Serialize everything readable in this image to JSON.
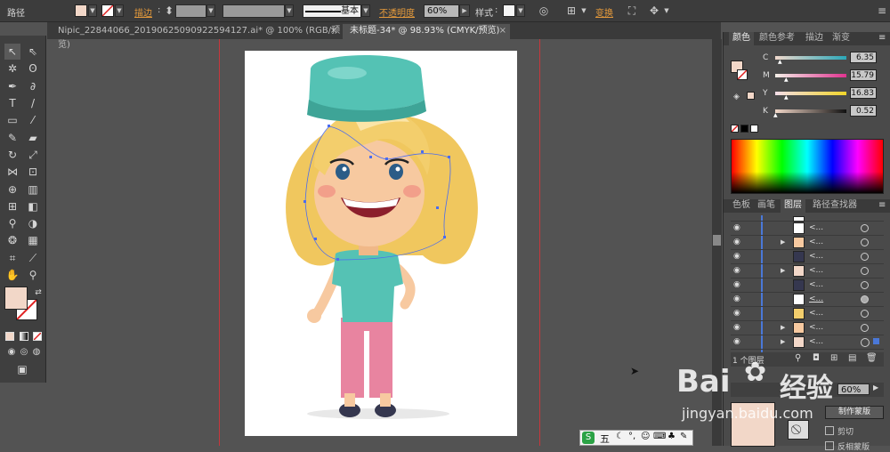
{
  "controlbar": {
    "mode_label": "路径",
    "stroke_label": "描边",
    "stroke_weight": "",
    "stroke_profile": "基本",
    "opacity_label": "不透明度",
    "opacity_value": "60%",
    "style_label": "样式",
    "transform_label": "变换",
    "fill_color": "#f2d7c8"
  },
  "tabs": [
    {
      "label": "Nipic_22844066_20190625090922594127.ai* @ 100% (RGB/预览)"
    },
    {
      "label": "未标题-34* @ 98.93% (CMYK/预览)"
    }
  ],
  "tab_close": "×",
  "panels": {
    "color_tabs": [
      "颜色",
      "颜色参考",
      "描边",
      "渐变"
    ],
    "cmyk": [
      {
        "channel": "C",
        "value": "6.35"
      },
      {
        "channel": "M",
        "value": "15.79"
      },
      {
        "channel": "Y",
        "value": "16.83"
      },
      {
        "channel": "K",
        "value": "0.52"
      }
    ],
    "layer_tabs": [
      "色板",
      "画笔",
      "图层",
      "路径查找器"
    ],
    "layer_rows": [
      {
        "name": "<...",
        "expand": ""
      },
      {
        "name": "<...",
        "expand": "▶"
      },
      {
        "name": "<...",
        "expand": ""
      },
      {
        "name": "<...",
        "expand": "▶"
      },
      {
        "name": "<...",
        "expand": ""
      },
      {
        "name": "<...",
        "expand": ""
      },
      {
        "name": "<...",
        "expand": ""
      },
      {
        "name": "<...",
        "expand": "▶"
      },
      {
        "name": "<...",
        "expand": "▶"
      },
      {
        "name": "<...",
        "expand": ""
      }
    ],
    "layer_count": "1 个图层",
    "opacity_bottom": "60%",
    "make_mask": "制作蒙版",
    "clip_label": "剪切",
    "invert_label": "反相蒙版"
  },
  "ime": {
    "label": "五"
  },
  "watermark": {
    "brand": "Bai",
    "brand2": "经验",
    "url": "jingyan.baidu.com"
  }
}
